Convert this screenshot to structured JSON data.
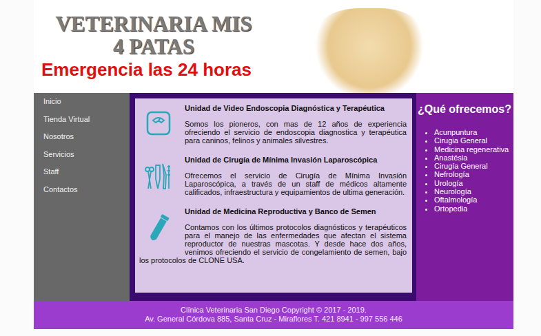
{
  "header": {
    "title_line1": "VETERINARIA MIS",
    "title_line2": "4 PATAS",
    "tagline": "Emergencia las 24 horas"
  },
  "nav": {
    "items": [
      "Inicio",
      "Tienda Virtual",
      "Nosotros",
      "Servicios",
      "Staff",
      "Contactos"
    ]
  },
  "services": [
    {
      "kind": "scale",
      "title": "Unidad de Video Endoscopia Diagnóstica y Terapéutica",
      "text": "Somos los pioneros, con mas de 12 años de experiencia ofreciendo el servicio de endoscopia diagnostica y terapéutica para caninos, felinos y animales silvestres."
    },
    {
      "kind": "instruments",
      "title": "Unidad de Cirugía de Mínima Invasión Laparoscópica",
      "text": "Ofrecemos el servicio de Cirugía de Mínima Invasión Laparoscópica, a través de un staff de médicos altamente calificados, infraestructura y equipamientos de ultima generación."
    },
    {
      "kind": "tube",
      "title": "Unidad de Medicina Reproductiva y Banco de Semen",
      "text": "Contamos con los últimos protocolos diagnósticos y terapéuticos para el manejo de las enfermedades que afectan el sistema reproductor de nuestras mascotas. Y desde hace dos años, venimos ofreciendo el servicio de congelamiento de semen, bajo los protocolos de CLONE USA."
    }
  ],
  "offers": {
    "title": "¿Qué ofrecemos?",
    "items": [
      "Acunpuntura",
      "Cirugia General",
      "Medicina regenerativa",
      "Anastésia",
      "Cirugía General",
      "Nefrología",
      "Urología",
      "Neurología",
      "Oftalmología",
      "Ortopedia"
    ]
  },
  "footer": {
    "line1": "Clínica Veterinaria San Diego Copyright © 2017 - 2019.",
    "line2": "Av. General Córdova 885, Santa Cruz - Miraflores T. 421 8941 - 997 556 446"
  }
}
